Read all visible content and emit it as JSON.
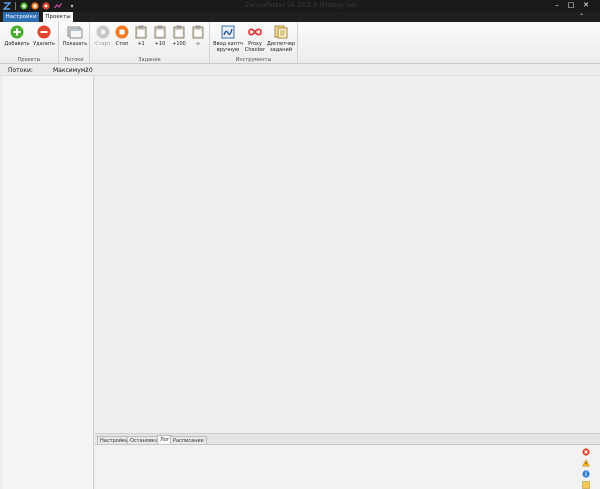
{
  "window": {
    "title": "ZennoPoster v5.10.2.0 (Enterprise)",
    "buttons": [
      "–",
      "□",
      "✕"
    ]
  },
  "quick_access": {
    "icons": [
      "app-logo-icon",
      "add-icon",
      "stop-icon",
      "record-icon",
      "chart-icon",
      "dropdown-icon"
    ]
  },
  "tabs": {
    "settings": "Настройки",
    "projects": "Проекты"
  },
  "ribbon": {
    "groups": {
      "projects": "Проекты",
      "threads": "Потоки",
      "task": "Задание",
      "tools": "Инструменты"
    },
    "buttons": {
      "add": "Добавить",
      "delete": "Удалить",
      "show": "Показать",
      "start": "Старт",
      "stop": "Стоп",
      "plus1": "+1",
      "plus10": "+10",
      "plus100": "+100",
      "infinity": "∞",
      "captcha_line1": "Ввод каптч",
      "captcha_line2": "вручную",
      "proxy_line1": "Proxy",
      "proxy_line2": "Checker",
      "dispatcher_line1": "Диспетчер",
      "dispatcher_line2": "заданий"
    }
  },
  "threads_bar": {
    "label": "Потоки:",
    "max_label": "Максимум:",
    "max_value": "20"
  },
  "bottom_tabs": [
    "Настройки",
    "Остановка",
    "Лог",
    "Расписание"
  ],
  "active_bottom_tab": "Лог",
  "colors": {
    "accent": "#2f6fb4",
    "green": "#4caf2b",
    "orange": "#f07a20",
    "red": "#e0452b"
  }
}
